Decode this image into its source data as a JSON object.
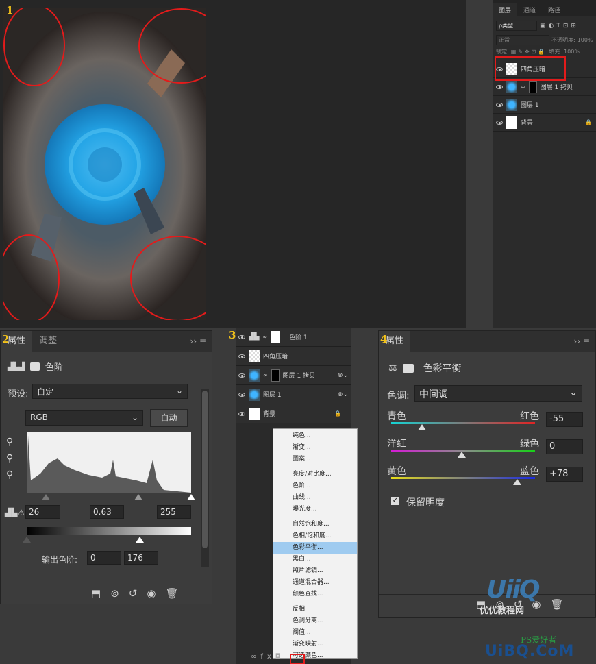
{
  "step_numbers": [
    "1",
    "2",
    "3",
    "4"
  ],
  "layers_panel_top": {
    "tabs": [
      "图层",
      "通道",
      "路径"
    ],
    "filter_label": "ρ类型",
    "blend_mode": "正常",
    "opacity_label": "不透明度:",
    "opacity_value": "100%",
    "lock_label": "锁定:",
    "fill_label": "填充:",
    "fill_value": "100%",
    "layers": [
      {
        "name": "四角压暗",
        "thumb": "checker",
        "highlighted": true
      },
      {
        "name": "图层 1 拷贝",
        "thumb": "photo",
        "mask": true
      },
      {
        "name": "图层 1",
        "thumb": "photo"
      },
      {
        "name": "背景",
        "thumb": "white",
        "locked": true
      }
    ]
  },
  "levels_panel": {
    "tabs": [
      "属性",
      "调整"
    ],
    "title": "色阶",
    "preset_label": "预设:",
    "preset_value": "自定",
    "channel_value": "RGB",
    "auto_button": "自动",
    "input_black": "26",
    "input_gamma": "0.63",
    "input_white": "255",
    "output_label": "输出色阶:",
    "output_black": "0",
    "output_white": "176"
  },
  "layers_menu_panel": {
    "layers": [
      {
        "name": "色阶 1",
        "type": "levels"
      },
      {
        "name": "四角压暗",
        "type": "checker"
      },
      {
        "name": "图层 1 拷贝",
        "type": "photo"
      },
      {
        "name": "图层 1",
        "type": "photo"
      },
      {
        "name": "背景",
        "type": "white"
      }
    ],
    "menu_items": [
      [
        "纯色...",
        "渐变...",
        "图案..."
      ],
      [
        "亮度/对比度...",
        "色阶...",
        "曲线...",
        "曝光度..."
      ],
      [
        "自然饱和度...",
        "色相/饱和度...",
        "色彩平衡...",
        "黑白...",
        "照片滤镜...",
        "通道混合器...",
        "颜色查找..."
      ],
      [
        "反相",
        "色调分离...",
        "阈值...",
        "渐变映射...",
        "可选颜色..."
      ]
    ],
    "selected_item": "色彩平衡..."
  },
  "color_balance_panel": {
    "tab": "属性",
    "title": "色彩平衡",
    "tone_label": "色调:",
    "tone_value": "中间调",
    "sliders": [
      {
        "left": "青色",
        "right": "红色",
        "value": "-55",
        "pos": 0.28
      },
      {
        "left": "洋红",
        "right": "绿色",
        "value": "0",
        "pos": 0.5
      },
      {
        "left": "黄色",
        "right": "蓝色",
        "value": "+78",
        "pos": 0.88
      }
    ],
    "preserve_label": "保留明度"
  },
  "watermark": {
    "brand": "优优教程网",
    "site": "UiBQ.CoM",
    "ps": "PS爱好者"
  }
}
